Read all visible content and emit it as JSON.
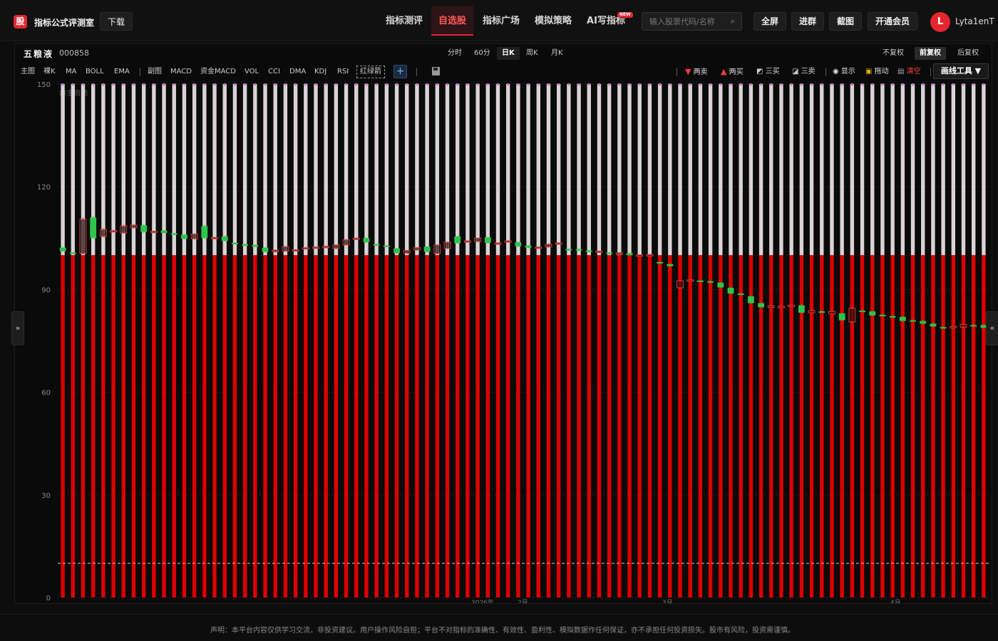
{
  "app": {
    "logo_glyph": "股",
    "brand": "指标公式评测室",
    "download": "下载"
  },
  "nav": {
    "items": [
      {
        "label": "指标测评",
        "active": false
      },
      {
        "label": "自选股",
        "active": true
      },
      {
        "label": "指标广场",
        "active": false
      },
      {
        "label": "模拟策略",
        "active": false
      },
      {
        "label": "AI写指标",
        "active": false
      }
    ],
    "new_badge": "NEW"
  },
  "search": {
    "placeholder": "输入股票代码/名称",
    "icon": "search-icon"
  },
  "top_buttons": {
    "fullscreen": "全屏",
    "join_group": "进群",
    "screenshot": "截图",
    "vip": "开通会员"
  },
  "user": {
    "avatar_letter": "L",
    "name": "Lyta1enT"
  },
  "stock": {
    "name": "五粮液",
    "code": "000858"
  },
  "periods": [
    {
      "label": "分时",
      "active": false
    },
    {
      "label": "60分",
      "active": false
    },
    {
      "label": "日K",
      "active": true
    },
    {
      "label": "周K",
      "active": false
    },
    {
      "label": "月K",
      "active": false
    }
  ],
  "adjust": [
    {
      "label": "不复权",
      "active": false
    },
    {
      "label": "前复权",
      "active": true
    },
    {
      "label": "后复权",
      "active": false
    }
  ],
  "indicators": [
    "主图",
    "裸K",
    "MA",
    "BOLL",
    "EMA",
    "副图",
    "MACD",
    "资金MACD",
    "VOL",
    "CCI",
    "DMA",
    "KDJ",
    "RSI",
    "红绿箭"
  ],
  "add_indicator": "+",
  "draw_tools": {
    "two_sell": "两卖",
    "two_buy": "两买",
    "three_buy": "三买",
    "three_sell": "三卖",
    "show": "显示",
    "drag": "拖动",
    "clear": "清空",
    "menu": "画线工具 ▼"
  },
  "colors": {
    "accent": "#e4262f",
    "up": "#e33b3b",
    "down": "#2cc54a",
    "bar_red": "#dd0000",
    "bar_white": "#d9d3d3",
    "dot": "#d06ad6"
  },
  "side_toggles": {
    "left": "»",
    "right": "«"
  },
  "footer": "声明：本平台内容仅供学习交流，非投资建议。用户操作风险自担；平台不对指标的准确性、有效性、盈利性、模拟数据作任何保证，亦不承担任何投资损失。股市有风险，投资需谨慎。",
  "chart_data": {
    "type": "bar",
    "y_ticks": [
      0,
      30,
      60,
      90,
      120,
      150
    ],
    "ylim": [
      0,
      150
    ],
    "x_ticks": [
      "2026年",
      "2月",
      "3月",
      "4月"
    ],
    "watermark": "命主启动",
    "reference_line": 10,
    "bar_split": 100,
    "bar_count": 92,
    "candles": [
      {
        "o": 102.2,
        "c": 101.2,
        "h": 102.5,
        "l": 101.0
      },
      {
        "o": 100.8,
        "c": 100.6,
        "h": 101.0,
        "l": 100.4
      },
      {
        "o": 100.5,
        "c": 110.5,
        "h": 111.0,
        "l": 100.3
      },
      {
        "o": 111.0,
        "c": 105.0,
        "h": 111.5,
        "l": 104.8
      },
      {
        "o": 105.5,
        "c": 107.5,
        "h": 108.0,
        "l": 105.2
      },
      {
        "o": 107.0,
        "c": 107.2,
        "h": 107.5,
        "l": 106.8
      },
      {
        "o": 106.5,
        "c": 108.5,
        "h": 109.0,
        "l": 106.3
      },
      {
        "o": 108.0,
        "c": 108.8,
        "h": 109.2,
        "l": 107.8
      },
      {
        "o": 108.8,
        "c": 106.8,
        "h": 109.0,
        "l": 106.5
      },
      {
        "o": 106.8,
        "c": 107.0,
        "h": 107.2,
        "l": 106.6
      },
      {
        "o": 107.2,
        "c": 106.5,
        "h": 107.4,
        "l": 106.3
      },
      {
        "o": 106.4,
        "c": 106.0,
        "h": 106.6,
        "l": 105.8
      },
      {
        "o": 106.0,
        "c": 104.8,
        "h": 106.2,
        "l": 104.6
      },
      {
        "o": 104.8,
        "c": 106.2,
        "h": 106.4,
        "l": 104.6
      },
      {
        "o": 108.5,
        "c": 105.0,
        "h": 108.8,
        "l": 104.8
      },
      {
        "o": 105.0,
        "c": 105.2,
        "h": 105.4,
        "l": 104.8
      },
      {
        "o": 105.5,
        "c": 104.2,
        "h": 105.7,
        "l": 104.0
      },
      {
        "o": 103.6,
        "c": 103.4,
        "h": 103.8,
        "l": 103.2
      },
      {
        "o": 103.2,
        "c": 103.0,
        "h": 103.4,
        "l": 102.8
      },
      {
        "o": 103.0,
        "c": 102.5,
        "h": 103.2,
        "l": 102.3
      },
      {
        "o": 102.2,
        "c": 101.0,
        "h": 102.4,
        "l": 100.8
      },
      {
        "o": 101.0,
        "c": 101.5,
        "h": 101.7,
        "l": 100.8
      },
      {
        "o": 101.2,
        "c": 102.5,
        "h": 102.7,
        "l": 101.0
      },
      {
        "o": 101.5,
        "c": 101.6,
        "h": 101.8,
        "l": 101.3
      },
      {
        "o": 102.0,
        "c": 102.2,
        "h": 102.4,
        "l": 101.8
      },
      {
        "o": 102.3,
        "c": 102.4,
        "h": 102.6,
        "l": 102.1
      },
      {
        "o": 102.5,
        "c": 102.6,
        "h": 102.8,
        "l": 102.3
      },
      {
        "o": 102.0,
        "c": 103.0,
        "h": 103.2,
        "l": 101.8
      },
      {
        "o": 103.0,
        "c": 104.5,
        "h": 104.8,
        "l": 102.8
      },
      {
        "o": 104.8,
        "c": 105.0,
        "h": 105.2,
        "l": 104.6
      },
      {
        "o": 105.0,
        "c": 103.8,
        "h": 105.2,
        "l": 103.6
      },
      {
        "o": 103.2,
        "c": 102.8,
        "h": 103.4,
        "l": 102.6
      },
      {
        "o": 102.8,
        "c": 102.6,
        "h": 103.0,
        "l": 102.4
      },
      {
        "o": 102.0,
        "c": 100.6,
        "h": 102.2,
        "l": 100.4
      },
      {
        "o": 100.6,
        "c": 101.4,
        "h": 101.6,
        "l": 100.4
      },
      {
        "o": 101.5,
        "c": 102.2,
        "h": 102.4,
        "l": 101.3
      },
      {
        "o": 102.5,
        "c": 101.0,
        "h": 102.7,
        "l": 100.8
      },
      {
        "o": 100.5,
        "c": 103.0,
        "h": 103.2,
        "l": 100.3
      },
      {
        "o": 102.0,
        "c": 103.8,
        "h": 104.0,
        "l": 101.8
      },
      {
        "o": 105.5,
        "c": 103.5,
        "h": 105.7,
        "l": 103.3
      },
      {
        "o": 104.0,
        "c": 104.2,
        "h": 104.4,
        "l": 103.8
      },
      {
        "o": 104.0,
        "c": 105.0,
        "h": 105.2,
        "l": 103.8
      },
      {
        "o": 105.2,
        "c": 103.6,
        "h": 105.4,
        "l": 103.4
      },
      {
        "o": 103.4,
        "c": 103.6,
        "h": 103.8,
        "l": 103.2
      },
      {
        "o": 104.0,
        "c": 104.2,
        "h": 104.4,
        "l": 103.8
      },
      {
        "o": 103.8,
        "c": 102.6,
        "h": 104.0,
        "l": 102.4
      },
      {
        "o": 102.8,
        "c": 102.2,
        "h": 103.0,
        "l": 102.0
      },
      {
        "o": 102.0,
        "c": 102.4,
        "h": 102.6,
        "l": 101.8
      },
      {
        "o": 102.4,
        "c": 103.2,
        "h": 103.4,
        "l": 102.2
      },
      {
        "o": 103.4,
        "c": 103.6,
        "h": 103.8,
        "l": 103.2
      },
      {
        "o": 101.8,
        "c": 101.6,
        "h": 102.0,
        "l": 101.4
      },
      {
        "o": 101.8,
        "c": 101.4,
        "h": 102.0,
        "l": 101.2
      },
      {
        "o": 101.4,
        "c": 101.0,
        "h": 101.6,
        "l": 100.8
      },
      {
        "o": 100.8,
        "c": 101.2,
        "h": 101.4,
        "l": 100.6
      },
      {
        "o": 100.8,
        "c": 100.4,
        "h": 101.0,
        "l": 100.2
      },
      {
        "o": 100.2,
        "c": 100.7,
        "h": 100.9,
        "l": 100.0
      },
      {
        "o": 100.6,
        "c": 100.0,
        "h": 100.8,
        "l": 99.8
      },
      {
        "o": 100.0,
        "c": 100.1,
        "h": 100.3,
        "l": 99.8
      },
      {
        "o": 100.0,
        "c": 100.2,
        "h": 100.4,
        "l": 99.8
      },
      {
        "o": 98.0,
        "c": 97.6,
        "h": 98.2,
        "l": 97.4
      },
      {
        "o": 97.4,
        "c": 96.8,
        "h": 97.6,
        "l": 96.6
      },
      {
        "o": 90.5,
        "c": 92.5,
        "h": 92.7,
        "l": 90.3
      },
      {
        "o": 92.6,
        "c": 92.8,
        "h": 93.0,
        "l": 92.4
      },
      {
        "o": 92.6,
        "c": 92.4,
        "h": 92.8,
        "l": 92.2
      },
      {
        "o": 92.4,
        "c": 92.0,
        "h": 92.6,
        "l": 91.8
      },
      {
        "o": 92.0,
        "c": 90.6,
        "h": 92.2,
        "l": 90.4
      },
      {
        "o": 90.5,
        "c": 88.8,
        "h": 90.7,
        "l": 88.6
      },
      {
        "o": 88.8,
        "c": 88.6,
        "h": 89.0,
        "l": 88.4
      },
      {
        "o": 88.0,
        "c": 86.0,
        "h": 88.2,
        "l": 85.8
      },
      {
        "o": 86.0,
        "c": 84.8,
        "h": 86.2,
        "l": 84.6
      },
      {
        "o": 85.0,
        "c": 85.2,
        "h": 85.4,
        "l": 84.8
      },
      {
        "o": 85.0,
        "c": 85.1,
        "h": 85.3,
        "l": 84.8
      },
      {
        "o": 85.2,
        "c": 85.4,
        "h": 85.6,
        "l": 85.0
      },
      {
        "o": 85.4,
        "c": 83.2,
        "h": 85.6,
        "l": 83.0
      },
      {
        "o": 83.2,
        "c": 83.8,
        "h": 84.0,
        "l": 83.0
      },
      {
        "o": 83.6,
        "c": 83.4,
        "h": 83.8,
        "l": 83.2
      },
      {
        "o": 82.8,
        "c": 83.6,
        "h": 83.8,
        "l": 82.6
      },
      {
        "o": 83.0,
        "c": 81.0,
        "h": 83.2,
        "l": 80.8
      },
      {
        "o": 80.5,
        "c": 84.5,
        "h": 85.0,
        "l": 80.3
      },
      {
        "o": 83.8,
        "c": 83.6,
        "h": 84.0,
        "l": 83.4
      },
      {
        "o": 83.6,
        "c": 82.4,
        "h": 83.8,
        "l": 82.2
      },
      {
        "o": 82.6,
        "c": 82.4,
        "h": 82.8,
        "l": 82.2
      },
      {
        "o": 82.2,
        "c": 82.0,
        "h": 82.4,
        "l": 81.8
      },
      {
        "o": 82.0,
        "c": 80.8,
        "h": 82.2,
        "l": 80.6
      },
      {
        "o": 81.0,
        "c": 80.8,
        "h": 81.2,
        "l": 80.6
      },
      {
        "o": 80.8,
        "c": 80.0,
        "h": 81.0,
        "l": 79.8
      },
      {
        "o": 80.0,
        "c": 79.2,
        "h": 80.2,
        "l": 79.0
      },
      {
        "o": 79.0,
        "c": 78.8,
        "h": 79.2,
        "l": 78.6
      },
      {
        "o": 79.0,
        "c": 79.2,
        "h": 79.4,
        "l": 78.8
      },
      {
        "o": 79.0,
        "c": 79.8,
        "h": 80.0,
        "l": 78.8
      },
      {
        "o": 79.6,
        "c": 79.4,
        "h": 79.8,
        "l": 79.2
      },
      {
        "o": 79.6,
        "c": 78.8,
        "h": 79.8,
        "l": 78.6
      }
    ]
  }
}
